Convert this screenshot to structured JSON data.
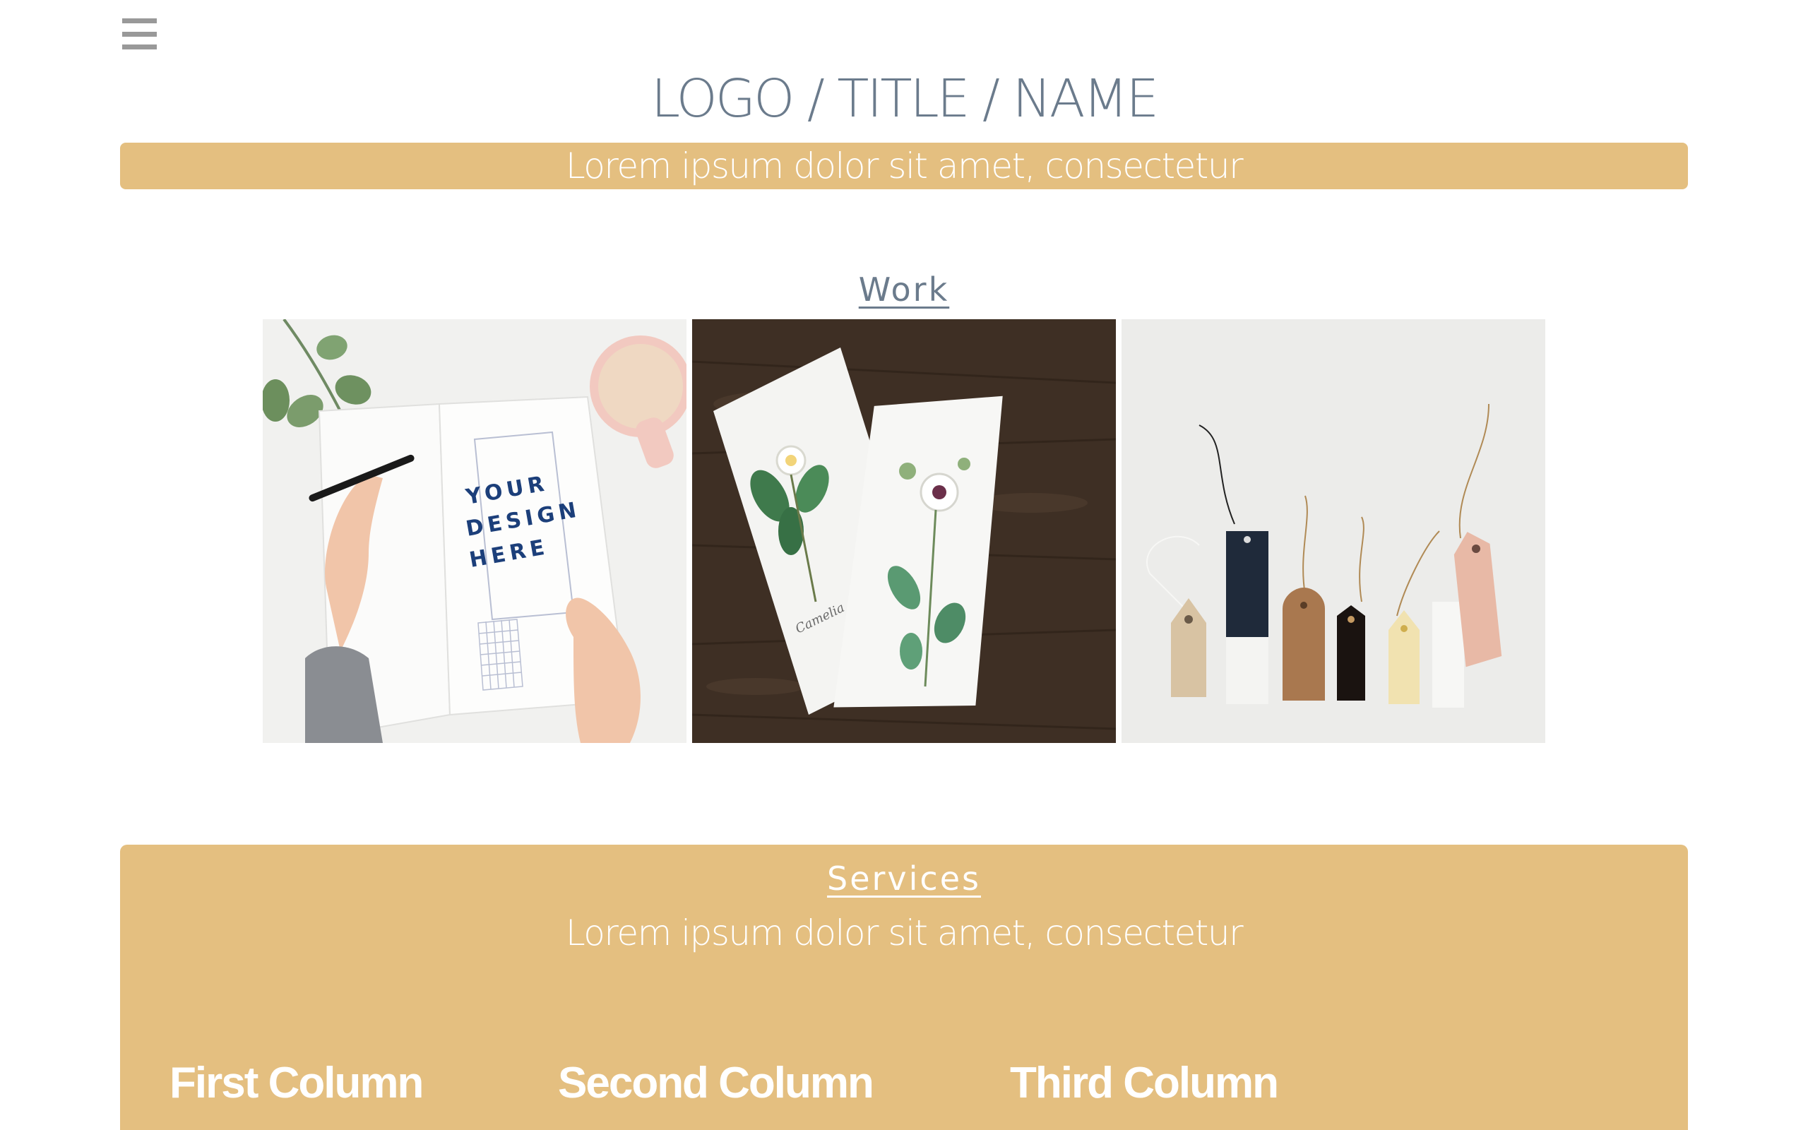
{
  "header": {
    "menu_icon": "hamburger-menu-icon",
    "logo_title": "LOGO / TITLE / NAME",
    "tagline": "Lorem ipsum dolor sit amet, consectetur"
  },
  "work": {
    "heading": "Work",
    "images": [
      {
        "name": "notebook-mockup-image",
        "overlay_text": [
          "YOUR",
          "DESIGN",
          "HERE"
        ],
        "book_caption": ""
      },
      {
        "name": "botanical-cards-image",
        "card_caption": "Camelia"
      },
      {
        "name": "kraft-tags-image"
      }
    ]
  },
  "services": {
    "heading": "Services",
    "subtitle": "Lorem ipsum dolor sit amet, consectetur",
    "columns": [
      "First Column",
      "Second Column",
      "Third Column"
    ]
  },
  "colors": {
    "accent": "#e4bf80",
    "title_text": "#6b7b8c",
    "menu_icon": "#999999",
    "background": "#ffffff"
  }
}
